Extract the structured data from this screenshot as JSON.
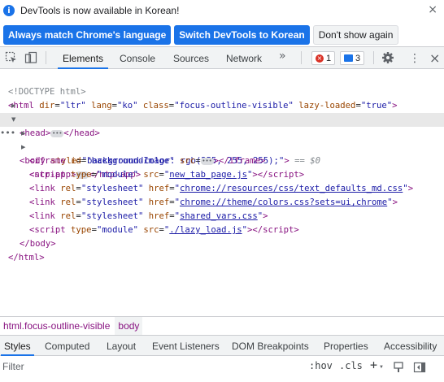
{
  "infobar": {
    "message": "DevTools is now available in Korean!",
    "buttons": {
      "always_match": "Always match Chrome's language",
      "switch": "Switch DevTools to Korean",
      "dont_show": "Don't show again"
    },
    "close": "×"
  },
  "toolbar": {
    "tabs": [
      "Elements",
      "Console",
      "Sources",
      "Network"
    ],
    "more": "»",
    "errors": "1",
    "messages": "3",
    "menu": "⋮",
    "close": "×"
  },
  "dom": {
    "doctype": "<!DOCTYPE html>",
    "html_open": {
      "tag": "html",
      "attrs": [
        [
          "dir",
          "ltr"
        ],
        [
          "lang",
          "ko"
        ],
        [
          "class",
          "focus-outline-visible"
        ],
        [
          "lazy-loaded",
          "true"
        ]
      ]
    },
    "head": "head",
    "body_style": "background-color: rgb(255, 255, 255);",
    "eq": "== $0",
    "iframe_id": "backgroundImage",
    "ntp_app": "ntp-app",
    "script1_src": "new_tab_page.js",
    "link1_href": "chrome://resources/css/text_defaults_md.css",
    "link2_href": "chrome://theme/colors.css?sets=ui,chrome",
    "link3_href": "shared_vars.css",
    "script2_src": "./lazy_load.js"
  },
  "breadcrumbs": [
    "html.focus-outline-visible",
    "body"
  ],
  "lower_tabs": [
    "Styles",
    "Computed",
    "Layout",
    "Event Listeners",
    "DOM Breakpoints",
    "Properties",
    "Accessibility"
  ],
  "filter": {
    "placeholder": "Filter",
    "hov": ":hov",
    "cls": ".cls",
    "add": "+"
  }
}
